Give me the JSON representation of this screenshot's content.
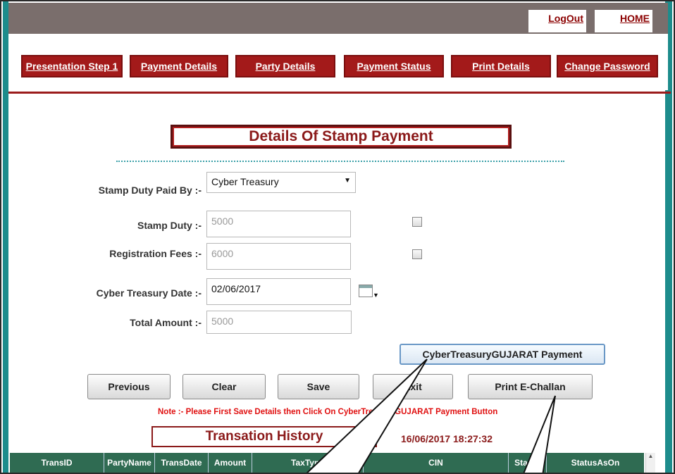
{
  "header": {
    "logout_label": "LogOut",
    "home_label": "HOME"
  },
  "nav": {
    "items": [
      {
        "label": "Presentation Step 1"
      },
      {
        "label": "Payment Details"
      },
      {
        "label": "Party Details"
      },
      {
        "label": "Payment Status"
      },
      {
        "label": "Print Details"
      },
      {
        "label": "Change Password"
      }
    ]
  },
  "form": {
    "title": "Details Of Stamp Payment",
    "paid_by_label": "Stamp Duty Paid By :-",
    "paid_by_value": "Cyber Treasury",
    "stamp_duty_label": "Stamp Duty :-",
    "stamp_duty_value": "5000",
    "reg_fees_label": "Registration Fees :-",
    "reg_fees_value": "6000",
    "date_label": "Cyber Treasury Date :-",
    "date_value": "02/06/2017",
    "total_label": "Total Amount :-",
    "total_value": "5000",
    "payment_button": "CyberTreasuryGUJARAT Payment"
  },
  "buttons": {
    "previous": "Previous",
    "clear": "Clear",
    "save": "Save",
    "exit": "Exit",
    "print": "Print E-Challan"
  },
  "note": "Note :- Please First Save Details then Click On CyberTreasuryGUJARAT Payment Button",
  "history": {
    "title": "Transation History",
    "datetime": "16/06/2017 18:27:32",
    "columns": [
      "TransID",
      "PartyName",
      "TransDate",
      "Amount",
      "TaxType",
      "CIN",
      "Status",
      "StatusAsOn"
    ]
  },
  "colors": {
    "nav_bg": "#a31a1a",
    "accent_red": "#8b1a1a",
    "teal": "#1d8c8c",
    "table_header": "#2f6b52"
  }
}
